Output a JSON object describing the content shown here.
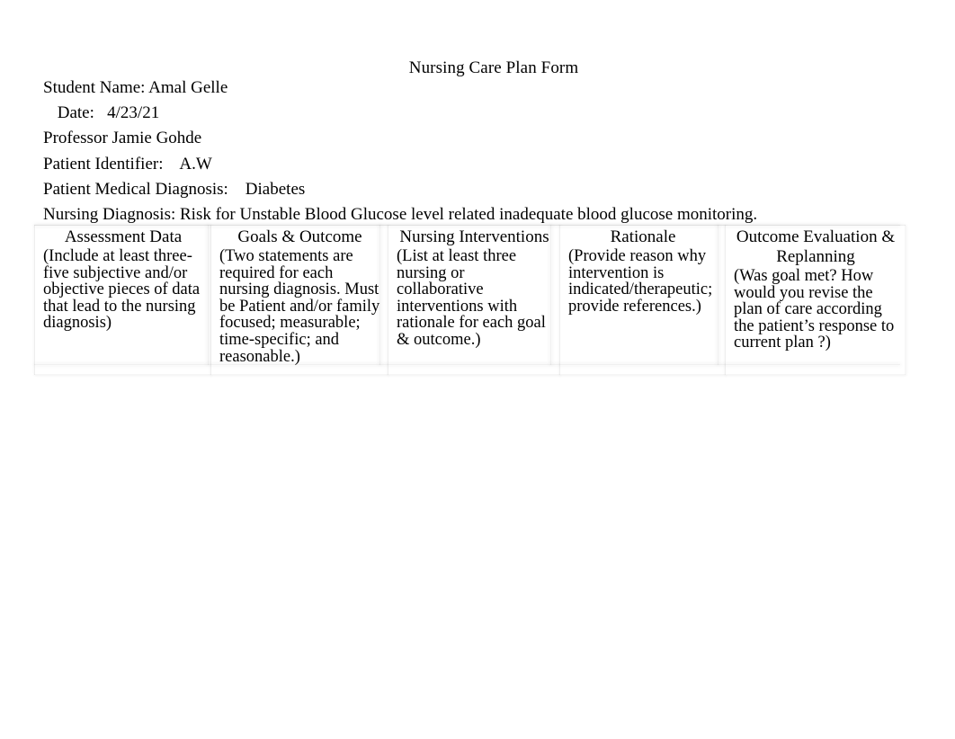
{
  "document": {
    "title": "Nursing Care Plan Form",
    "fields": [
      {
        "name": "student-name",
        "text": "Student Name: Amal Gelle",
        "indent": false
      },
      {
        "name": "date",
        "text": " Date:   4/23/21",
        "indent": true
      },
      {
        "name": "professor",
        "text": "Professor Jamie Gohde",
        "indent": false
      },
      {
        "name": "patient-identifier",
        "text": "Patient Identifier:    A.W",
        "indent": false
      },
      {
        "name": "patient-medical-diagnosis",
        "text": "Patient Medical Diagnosis:    Diabetes",
        "indent": false
      },
      {
        "name": "nursing-diagnosis",
        "text": "Nursing Diagnosis: Risk for Unstable Blood Glucose level related inadequate blood glucose monitoring.",
        "indent": false
      }
    ]
  },
  "table": {
    "columns": [
      {
        "header": "Assessment Data",
        "description": "(Include  at least three-five subjective and/or objective pieces of data that lead to the nursing diagnosis)",
        "value": ""
      },
      {
        "header": "Goals & Outcome",
        "description": "(Two statements are required for each nursing diagnosis.  Must be Patient and/or family focused; measurable; time-specific; and reasonable.)",
        "value": ""
      },
      {
        "header": "Nursing Interventions",
        "description": "(List at least three nursing or collaborative interventions with rationale for each goal & outcome.)",
        "value": ""
      },
      {
        "header": "Rationale",
        "description": "(Provide reason why intervention is indicated/therapeutic; provide references.)",
        "value": ""
      },
      {
        "header": "Outcome Evaluation & Replanning",
        "description": "(Was goal met?  How would you revise the plan of care according the patient’s response to current plan ?)",
        "value": ""
      }
    ]
  },
  "colors": {
    "page_background": "#ffffff",
    "text": "#000000",
    "rule": "#d9d9d9"
  }
}
